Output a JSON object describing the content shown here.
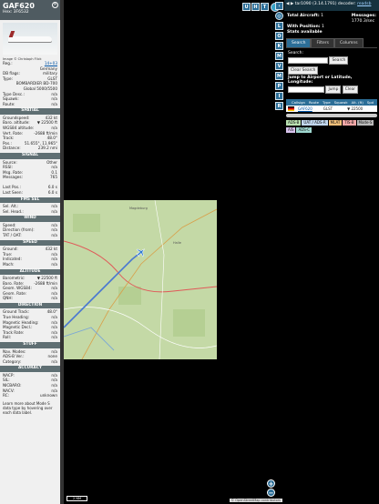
{
  "aircraft": {
    "callsign": "GAF620",
    "hex_line": "Hex: 3F6532",
    "close": "✕",
    "photo_caption": "Image © Christoph Flick"
  },
  "info_rows": [
    {
      "k": "Reg.:",
      "v": "14+03"
    },
    {
      "k": "",
      "v": "Germany"
    },
    {
      "k": "DB flags:",
      "v": "military"
    },
    {
      "k": "Type:",
      "v": "GLST"
    },
    {
      "k": "",
      "v": "BOMBARDIER BD-700"
    },
    {
      "k": "",
      "v": "Global 5000/5500"
    },
    {
      "k": "Type Desc.:",
      "v": "n/a"
    },
    {
      "k": "Squawk:",
      "v": "n/a"
    },
    {
      "k": "Route:",
      "v": "n/a"
    }
  ],
  "sections": [
    {
      "title": "SPATIAL",
      "rows": [
        {
          "k": "Groundspeed:",
          "v": "432 kt"
        },
        {
          "k": "Baro. altitude:",
          "v": "▼ 22500 ft"
        },
        {
          "k": "WGS84 altitude:",
          "v": "n/a"
        },
        {
          "k": "Vert. Rate:",
          "v": "-2688 ft/min"
        },
        {
          "k": "Track:",
          "v": "48.0°"
        },
        {
          "k": "Pos.:",
          "v": "51.655°, 11.965°"
        },
        {
          "k": "Distance:",
          "v": "239.2 nmi"
        }
      ]
    },
    {
      "title": "SIGNAL",
      "rows": [
        {
          "k": "Source:",
          "v": "Other"
        },
        {
          "k": "RSSI:",
          "v": "n/a"
        },
        {
          "k": "Msg. Rate:",
          "v": "0.1"
        },
        {
          "k": "Messages:",
          "v": "765"
        },
        {
          "k": "",
          "v": ""
        },
        {
          "k": "Last Pos.:",
          "v": "6.0 s"
        },
        {
          "k": "Last Seen:",
          "v": "6.0 s"
        }
      ]
    },
    {
      "title": "FMS SEL",
      "rows": [
        {
          "k": "Sel. Alt.:",
          "v": "n/a"
        },
        {
          "k": "Sel. Head.:",
          "v": "n/a"
        }
      ]
    },
    {
      "title": "WIND",
      "rows": [
        {
          "k": "Speed:",
          "v": "n/a"
        },
        {
          "k": "Direction (from):",
          "v": "n/a"
        },
        {
          "k": "TAT / OAT:",
          "v": "n/a"
        }
      ]
    },
    {
      "title": "SPEED",
      "rows": [
        {
          "k": "Ground:",
          "v": "432 kt"
        },
        {
          "k": "True:",
          "v": "n/a"
        },
        {
          "k": "Indicated:",
          "v": "n/a"
        },
        {
          "k": "Mach:",
          "v": "n/a"
        }
      ]
    },
    {
      "title": "ALTITUDE",
      "rows": [
        {
          "k": "Barometric:",
          "v": "▼ 22500 ft"
        },
        {
          "k": "Baro. Rate:",
          "v": "-2688 ft/min"
        },
        {
          "k": "Geom. WGS84:",
          "v": "n/a"
        },
        {
          "k": "Geom. Rate:",
          "v": "n/a"
        },
        {
          "k": "QNH:",
          "v": "n/a"
        }
      ]
    },
    {
      "title": "DIRECTION",
      "rows": [
        {
          "k": "Ground Track:",
          "v": "48.0°"
        },
        {
          "k": "True Heading:",
          "v": "n/a"
        },
        {
          "k": "Magnetic Heading:",
          "v": "n/a"
        },
        {
          "k": "Magnetic Decl.:",
          "v": "n/a"
        },
        {
          "k": "Track Rate:",
          "v": "n/a"
        },
        {
          "k": "Roll:",
          "v": "n/a"
        }
      ]
    },
    {
      "title": "STUFF",
      "rows": [
        {
          "k": "Nav. Modes:",
          "v": "n/a"
        },
        {
          "k": "ADS-B Ver.:",
          "v": "none"
        },
        {
          "k": "Category:",
          "v": "n/a"
        }
      ]
    },
    {
      "title": "ACCURACY",
      "rows": [
        {
          "k": "NACP:",
          "v": "n/a"
        },
        {
          "k": "SIL:",
          "v": "n/a"
        },
        {
          "k": "NICBARO:",
          "v": "n/a"
        },
        {
          "k": "NACV:",
          "v": "n/a"
        },
        {
          "k": "RC:",
          "v": "unknown"
        }
      ]
    }
  ],
  "footer_text": "Learn more about Mode S data type by hovering over each data label.",
  "map": {
    "top_buttons": [
      "U",
      "H",
      "T"
    ],
    "scale_text": "2 NM",
    "attribution": "© OpenStreetMap contributors",
    "zoom_in": "+",
    "zoom_out": "−",
    "town_labels": [
      "Magdeburg",
      "Halle"
    ]
  },
  "vstrip": {
    "buttons": [
      "L",
      "O",
      "K",
      "M",
      "V",
      "M",
      "P",
      "I",
      "R"
    ]
  },
  "right": {
    "version_text": "tar1090 (3.14.1791) decoder: ",
    "readsb_link": "readsb",
    "total_aircraft_label": "Total Aircraft:",
    "total_aircraft": "1",
    "messages_label": "Messages:",
    "messages_value": "1770.3/sec",
    "with_position_label": "With Position:",
    "with_position": "1",
    "stats_text": "Stats available",
    "tabs": [
      "Search",
      "Filters",
      "Columns"
    ],
    "search_label": "Search:",
    "search_button": "Search",
    "clear_search_button": "Clear Search",
    "jump_label": "Jump to Airport or Latitude, Longitude:",
    "jump_button": "Jump",
    "clear_button": "Clear",
    "table_headers": [
      "Callsign",
      "Route",
      "Type",
      "Squawk",
      "Alt. (ft)",
      "Spd"
    ],
    "table_row": {
      "flag": "DE",
      "callsign": "GAF620",
      "route": "",
      "type": "GLST",
      "squawk": "",
      "alt": "▼ 22500",
      "spd": ""
    },
    "badges": [
      {
        "label": "ADS-B",
        "color": "#b8e0b0"
      },
      {
        "label": "UAT / ADS-R",
        "color": "#c2d8ef"
      },
      {
        "label": "MLAT",
        "color": "#f3c07a"
      },
      {
        "label": "TIS-B",
        "color": "#f3a7a7"
      },
      {
        "label": "Mode-S",
        "color": "#bbbbbb"
      },
      {
        "label": "AIS",
        "color": "#d9c4ee"
      },
      {
        "label": "ADS-C",
        "color": "#9fd8d0"
      }
    ]
  }
}
